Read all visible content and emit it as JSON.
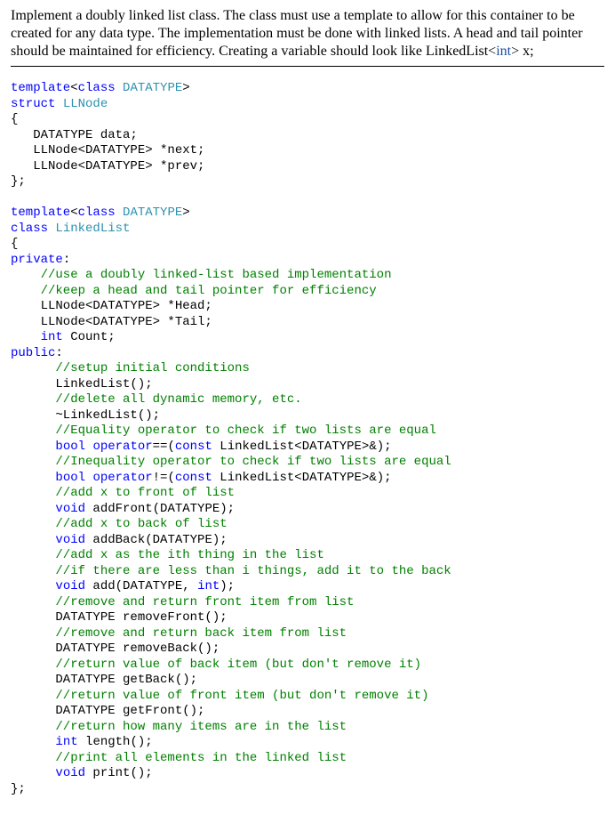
{
  "description": {
    "part1": "Implement a doubly linked list class.  The class must use a template to allow for this container to be created for any data type.  The implementation must be done with linked lists.  A head and tail pointer should be maintained for efficiency.  Creating a variable should look like LinkedList<",
    "typeword": "int",
    "part2": "> x;"
  },
  "code": {
    "l01a": "template",
    "l01b": "<",
    "l01c": "class",
    "l01d": " ",
    "l01e": "DATATYPE",
    "l01f": ">",
    "l02a": "struct",
    "l02b": " ",
    "l02c": "LLNode",
    "l03": "{",
    "l04a": "   DATATYPE data;",
    "l05a": "   LLNode<DATATYPE> *next;",
    "l06a": "   LLNode<DATATYPE> *prev;",
    "l07": "};",
    "blank1": "",
    "l08a": "template",
    "l08b": "<",
    "l08c": "class",
    "l08d": " ",
    "l08e": "DATATYPE",
    "l08f": ">",
    "l09a": "class",
    "l09b": " ",
    "l09c": "LinkedList",
    "l10": "{",
    "l11a": "private",
    "l11b": ":",
    "l12": "    //use a doubly linked-list based implementation",
    "l13": "    //keep a head and tail pointer for efficiency",
    "l14": "    LLNode<DATATYPE> *Head;",
    "l15": "    LLNode<DATATYPE> *Tail;",
    "l16a": "    ",
    "l16b": "int",
    "l16c": " Count;",
    "l17a": "public",
    "l17b": ":",
    "l18": "      //setup initial conditions",
    "l19": "      LinkedList();",
    "l20": "      //delete all dynamic memory, etc.",
    "l21": "      ~LinkedList();",
    "l22": "      //Equality operator to check if two lists are equal",
    "l23a": "      ",
    "l23b": "bool",
    "l23c": " ",
    "l23d": "operator",
    "l23e": "==(",
    "l23f": "const",
    "l23g": " LinkedList<DATATYPE>&);",
    "l24": "      //Inequality operator to check if two lists are equal",
    "l25a": "      ",
    "l25b": "bool",
    "l25c": " ",
    "l25d": "operator",
    "l25e": "!=(",
    "l25f": "const",
    "l25g": " LinkedList<DATATYPE>&);",
    "l26": "      //add x to front of list",
    "l27a": "      ",
    "l27b": "void",
    "l27c": " addFront(DATATYPE);",
    "l28": "      //add x to back of list",
    "l29a": "      ",
    "l29b": "void",
    "l29c": " addBack(DATATYPE);",
    "l30": "      //add x as the ith thing in the list",
    "l31": "      //if there are less than i things, add it to the back",
    "l32a": "      ",
    "l32b": "void",
    "l32c": " add(DATATYPE, ",
    "l32d": "int",
    "l32e": ");",
    "l33": "      //remove and return front item from list",
    "l34": "      DATATYPE removeFront();",
    "l35": "      //remove and return back item from list",
    "l36": "      DATATYPE removeBack();",
    "l37": "      //return value of back item (but don't remove it)",
    "l38": "      DATATYPE getBack();",
    "l39": "      //return value of front item (but don't remove it)",
    "l40": "      DATATYPE getFront();",
    "l41": "      //return how many items are in the list",
    "l42a": "      ",
    "l42b": "int",
    "l42c": " length();",
    "l43": "      //print all elements in the linked list",
    "l44a": "      ",
    "l44b": "void",
    "l44c": " print();",
    "l45": "};"
  }
}
